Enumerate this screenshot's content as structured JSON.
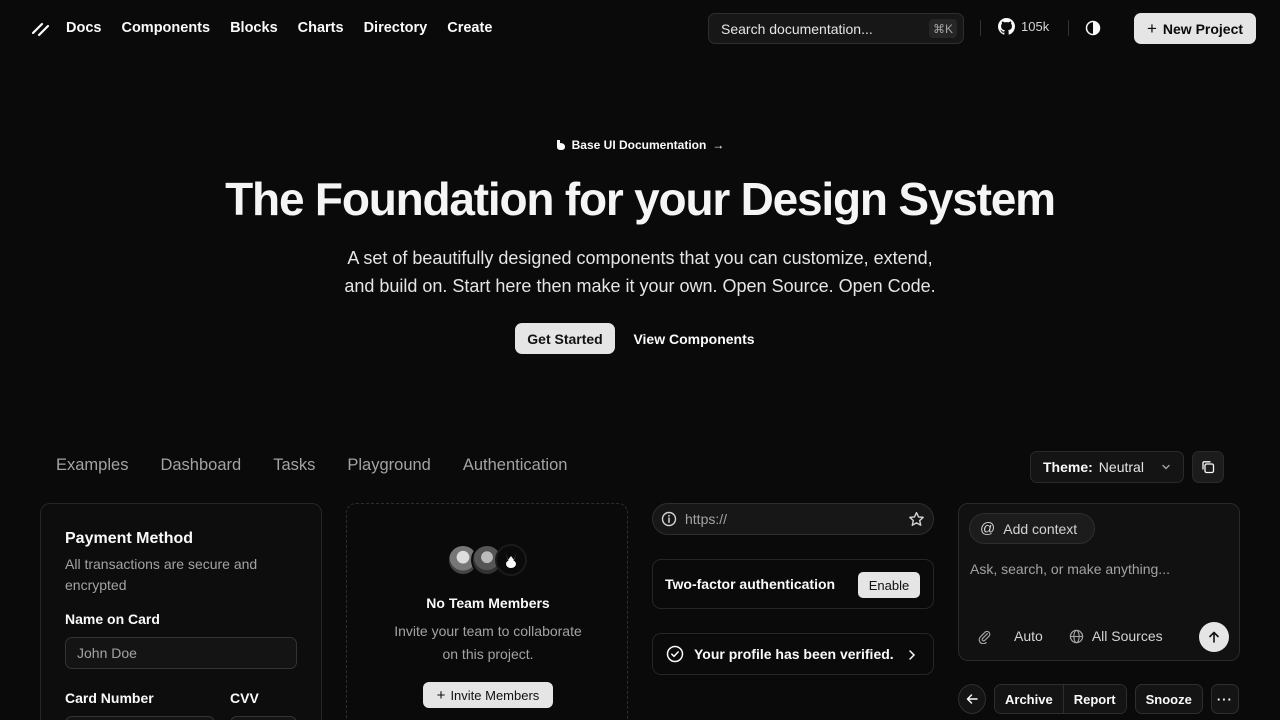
{
  "nav": {
    "items": [
      "Docs",
      "Components",
      "Blocks",
      "Charts",
      "Directory",
      "Create"
    ]
  },
  "search": {
    "placeholder": "Search documentation...",
    "shortcut": "⌘K"
  },
  "github": {
    "stars": "105k"
  },
  "header": {
    "new_project": "New Project"
  },
  "hero": {
    "badge": "Base UI Documentation",
    "title": "The Foundation for your Design System",
    "subtitle_line1": "A set of beautifully designed components that you can customize, extend,",
    "subtitle_line2": "and build on. Start here then make it your own. Open Source. Open Code.",
    "primary_cta": "Get Started",
    "secondary_cta": "View Components"
  },
  "examples": {
    "tabs": [
      "Examples",
      "Dashboard",
      "Tasks",
      "Playground",
      "Authentication"
    ],
    "theme_label": "Theme:",
    "theme_value": "Neutral"
  },
  "payment": {
    "title": "Payment Method",
    "description": "All transactions are secure and encrypted",
    "name_label": "Name on Card",
    "name_placeholder": "John Doe",
    "card_label": "Card Number",
    "cvv_label": "CVV"
  },
  "team": {
    "title": "No Team Members",
    "description": "Invite your team to collaborate on this project.",
    "invite": "Invite Members"
  },
  "url_bar": {
    "placeholder": "https://"
  },
  "twofa": {
    "label": "Two-factor authentication",
    "button": "Enable"
  },
  "verified": {
    "text": "Your profile has been verified."
  },
  "ai": {
    "context_chip": "Add context",
    "placeholder": "Ask, search, or make anything...",
    "mode": "Auto",
    "sources": "All Sources"
  },
  "mail": {
    "archive": "Archive",
    "report": "Report",
    "snooze": "Snooze"
  }
}
